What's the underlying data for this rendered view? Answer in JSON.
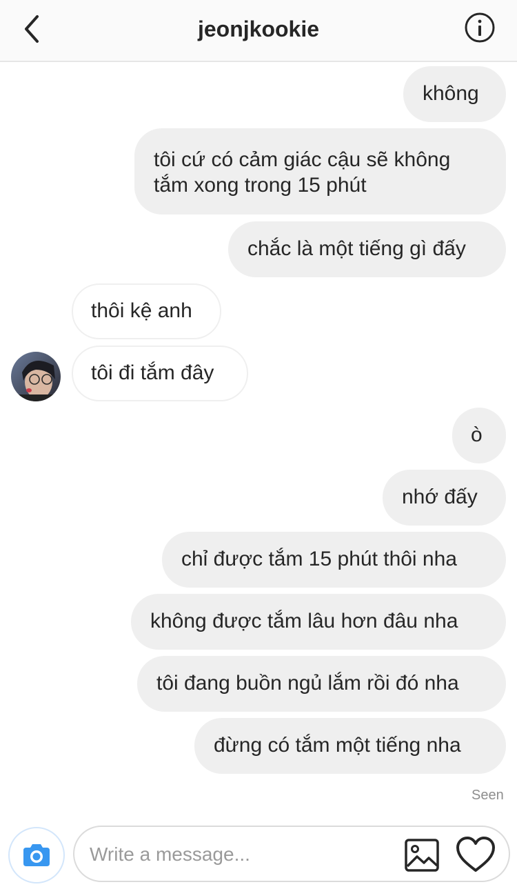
{
  "header": {
    "title": "jeonjkookie",
    "back_icon": "chevron-left-icon",
    "info_icon": "info-icon"
  },
  "messages": [
    {
      "direction": "sent",
      "text": "không"
    },
    {
      "direction": "sent",
      "lines": [
        "tôi cứ có cảm giác cậu sẽ không",
        "tắm xong trong 15 phút"
      ]
    },
    {
      "direction": "sent",
      "text": "chắc là một tiếng gì đấy"
    },
    {
      "direction": "received",
      "text": "thôi kệ anh"
    },
    {
      "direction": "received",
      "text": "tôi đi tắm đây"
    },
    {
      "direction": "sent",
      "text": "ò"
    },
    {
      "direction": "sent",
      "text": "nhớ đấy"
    },
    {
      "direction": "sent",
      "text": "chỉ được tắm 15 phút thôi nha"
    },
    {
      "direction": "sent",
      "text": "không được tắm lâu hơn đâu nha"
    },
    {
      "direction": "sent",
      "text": "tôi đang buồn ngủ lắm rồi đó nha"
    },
    {
      "direction": "sent",
      "text": "đừng có tắm một tiếng nha"
    }
  ],
  "seen_label": "Seen",
  "composer": {
    "placeholder": "Write a message...",
    "camera_icon": "camera-icon",
    "gallery_icon": "image-icon",
    "heart_icon": "heart-icon"
  },
  "colors": {
    "sent_bubble": "#efefef",
    "received_border": "#efefef",
    "camera_blue": "#3897f0",
    "text": "#262626",
    "muted": "#8e8e8e"
  }
}
